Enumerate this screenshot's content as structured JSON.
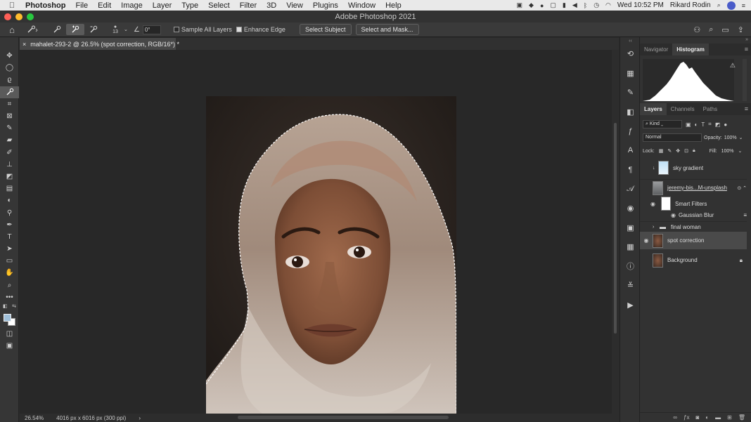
{
  "menubar": {
    "apple_icon": "apple-logo",
    "app_name": "Photoshop",
    "menus": [
      "File",
      "Edit",
      "Image",
      "Layer",
      "Type",
      "Select",
      "Filter",
      "3D",
      "View",
      "Plugins",
      "Window",
      "Help"
    ],
    "clock": "Wed 10:52 PM",
    "user": "Rikard Rodin"
  },
  "window": {
    "title": "Adobe Photoshop 2021",
    "lights": [
      "#fe5f57",
      "#febc2e",
      "#28c840"
    ]
  },
  "options": {
    "brush_size": "13",
    "angle": "0°",
    "sample_all_layers": "Sample All Layers",
    "sample_all_checked": false,
    "enhance_edge": "Enhance Edge",
    "enhance_edge_checked": true,
    "select_subject": "Select Subject",
    "select_and_mask": "Select and Mask..."
  },
  "document": {
    "tab_title": "mahalet-293-2 @ 26.5% (spot correction, RGB/16*) *",
    "close": "×",
    "zoom": "26.54%",
    "doc_info": "4016 px x 6016 px (300 ppi)",
    "more": "›"
  },
  "panels": {
    "histogram_tabs": [
      "Navigator",
      "Histogram"
    ],
    "histogram_active": "Histogram",
    "warning": "⚠",
    "layers_tabs": [
      "Layers",
      "Channels",
      "Paths"
    ],
    "layers_active": "Layers",
    "kind": "Kind",
    "blend_mode": "Normal",
    "opacity_label": "Opacity:",
    "opacity": "100%",
    "lock_label": "Lock:",
    "fill_label": "Fill:",
    "fill": "100%"
  },
  "layers": [
    {
      "name": "sky gradient",
      "visible": false
    },
    {
      "name": "jeremy-bis...M-unsplash",
      "visible": false
    },
    {
      "name": "Smart Filters",
      "visible": true
    },
    {
      "name": "Gaussian Blur",
      "visible": true
    },
    {
      "name": "final woman",
      "visible": false
    },
    {
      "name": "spot correction",
      "visible": true,
      "selected": true
    },
    {
      "name": "Background",
      "visible": false,
      "locked": true
    }
  ],
  "colors": {
    "foreground": "#9fbfd9",
    "background": "#ffffff",
    "histogram_fill": "#ffffff"
  }
}
